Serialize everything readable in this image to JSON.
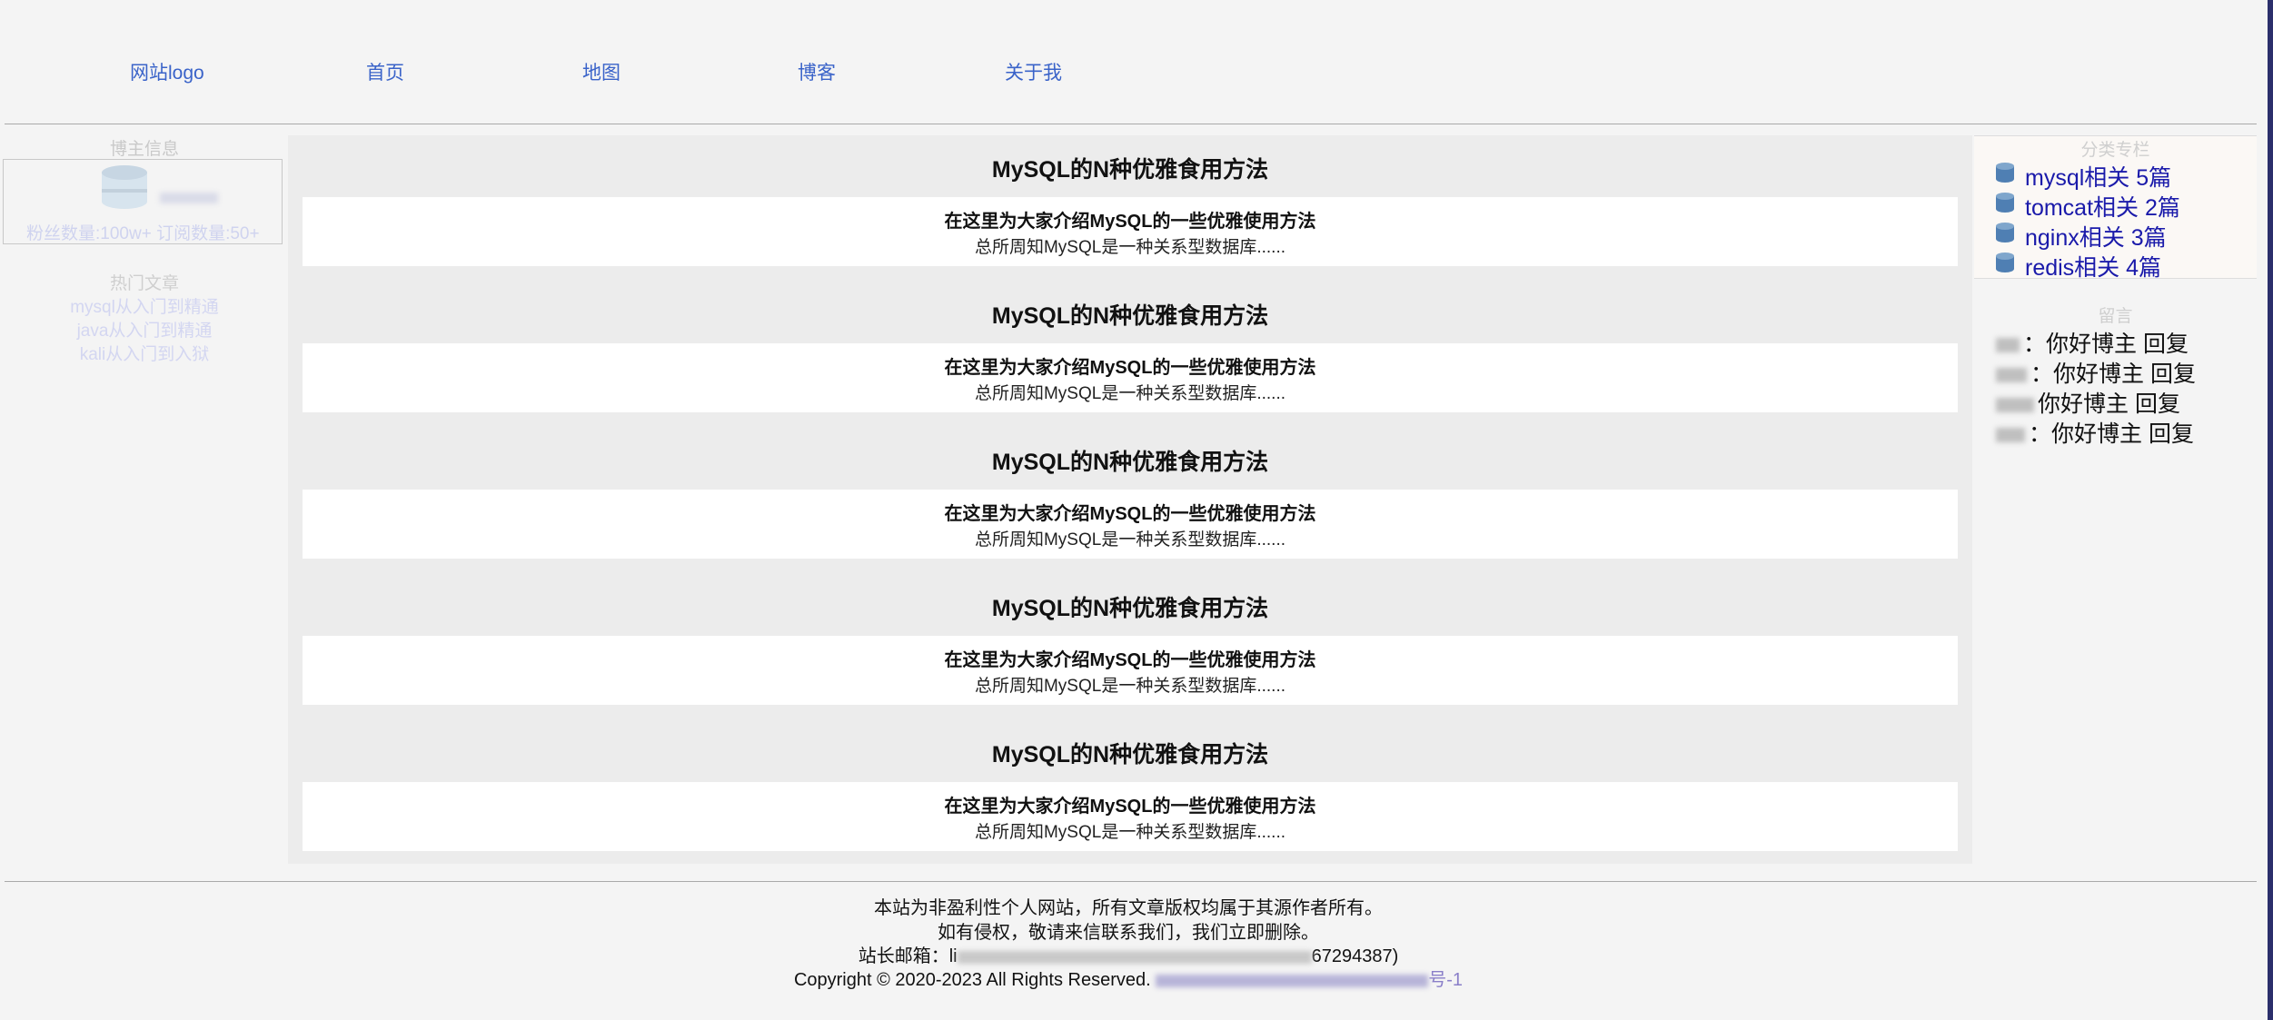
{
  "nav": {
    "logo": "网站logo",
    "items": [
      "首页",
      "地图",
      "博客",
      "关于我"
    ]
  },
  "left": {
    "blogger_title": "博主信息",
    "fans_line": "粉丝数量:100w+ 订阅数量:50+",
    "hot_title": "热门文章",
    "hot_articles": [
      "mysql从入门到精通",
      "java从入门到精通",
      "kali从入门到入狱"
    ]
  },
  "articles": [
    {
      "title": "MySQL的N种优雅食用方法",
      "subtitle": "在这里为大家介绍MySQL的一些优雅使用方法",
      "desc": "总所周知MySQL是一种关系型数据库......"
    },
    {
      "title": "MySQL的N种优雅食用方法",
      "subtitle": "在这里为大家介绍MySQL的一些优雅使用方法",
      "desc": "总所周知MySQL是一种关系型数据库......"
    },
    {
      "title": "MySQL的N种优雅食用方法",
      "subtitle": "在这里为大家介绍MySQL的一些优雅使用方法",
      "desc": "总所周知MySQL是一种关系型数据库......"
    },
    {
      "title": "MySQL的N种优雅食用方法",
      "subtitle": "在这里为大家介绍MySQL的一些优雅使用方法",
      "desc": "总所周知MySQL是一种关系型数据库......"
    },
    {
      "title": "MySQL的N种优雅食用方法",
      "subtitle": "在这里为大家介绍MySQL的一些优雅使用方法",
      "desc": "总所周知MySQL是一种关系型数据库......"
    }
  ],
  "right": {
    "category_title": "分类专栏",
    "categories": [
      "mysql相关 5篇",
      "tomcat相关 2篇",
      "nginx相关 3篇",
      "redis相关 4篇"
    ],
    "message_title": "留言",
    "messages": [
      {
        "text": "：你好博主",
        "reply": "回复"
      },
      {
        "text": "：你好博主",
        "reply": "回复"
      },
      {
        "text": "你好博主",
        "reply": "回复"
      },
      {
        "text": "：你好博主",
        "reply": "回复"
      }
    ]
  },
  "footer": {
    "line1": "本站为非盈利性个人网站，所有文章版权均属于其源作者所有。",
    "line2": "如有侵权，敬请来信联系我们，我们立即删除。",
    "line3_prefix": "站长邮箱：",
    "line3_partial": "li",
    "line3_suffix": "67294387)",
    "line4_prefix": "Copyright © 2020-2023 All Rights Reserved.",
    "line4_suffix": "号-1"
  },
  "colors": {
    "nav_link": "#3a63c9",
    "category_link": "#1a1aaa",
    "faded_text": "#cfd3ef",
    "main_bg": "#ececec",
    "page_bg": "#f4f4f4"
  }
}
